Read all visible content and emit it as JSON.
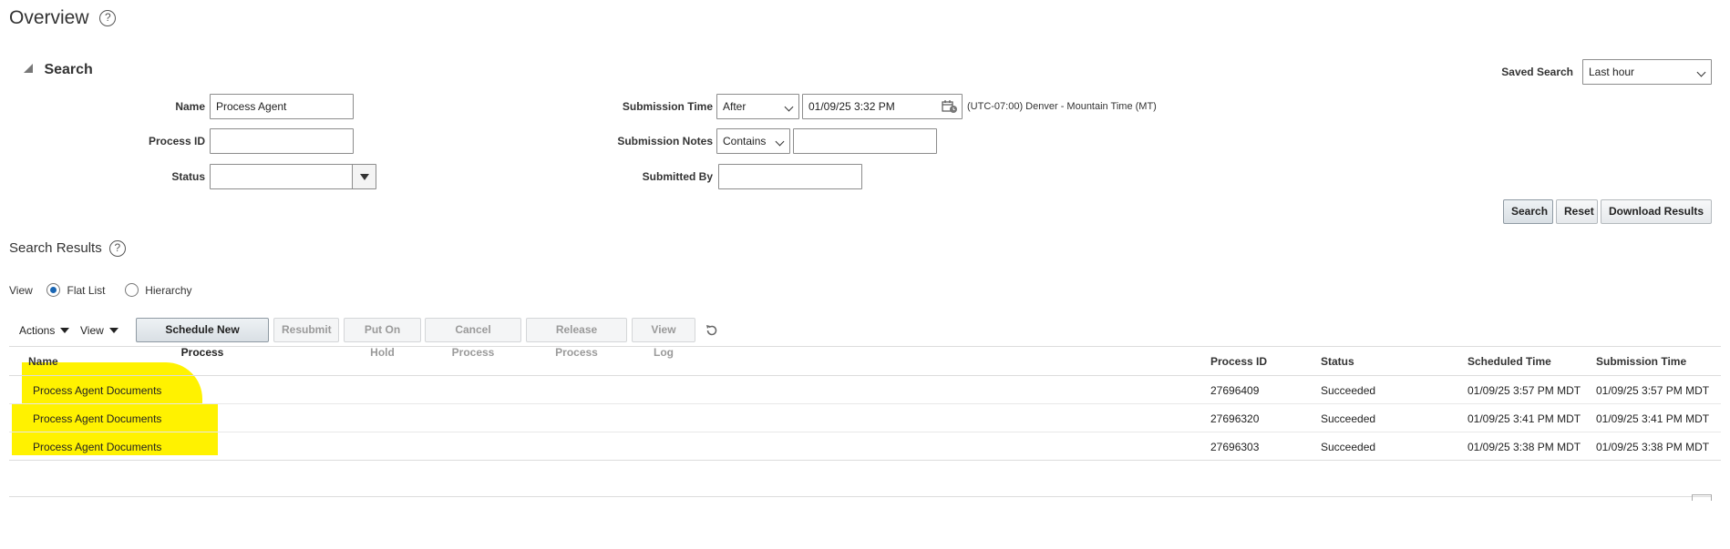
{
  "page": {
    "title": "Overview"
  },
  "search": {
    "header": "Search",
    "saved_search_label": "Saved Search",
    "saved_search_value": "Last hour",
    "name_label": "Name",
    "name_value": "Process Agent",
    "process_id_label": "Process ID",
    "process_id_value": "",
    "status_label": "Status",
    "status_value": "",
    "submission_time_label": "Submission Time",
    "submission_time_op": "After",
    "submission_time_value": "01/09/25 3:32 PM",
    "timezone": "(UTC-07:00) Denver - Mountain Time (MT)",
    "submission_notes_label": "Submission Notes",
    "submission_notes_op": "Contains",
    "submission_notes_value": "",
    "submitted_by_label": "Submitted By",
    "submitted_by_value": "",
    "buttons": {
      "search": "Search",
      "reset": "Reset",
      "download": "Download Results"
    }
  },
  "results": {
    "header": "Search Results",
    "view_label": "View",
    "view_options": [
      "Flat List",
      "Hierarchy"
    ],
    "view_selected": "Flat List",
    "toolbar": {
      "actions": "Actions",
      "view": "View",
      "schedule": "Schedule New Process",
      "resubmit": "Resubmit",
      "put_on_hold": "Put On Hold",
      "cancel": "Cancel Process",
      "release": "Release Process",
      "view_log": "View Log"
    },
    "columns": [
      "Name",
      "Process ID",
      "Status",
      "Scheduled Time",
      "Submission Time"
    ],
    "rows": [
      {
        "name": "Process Agent Documents",
        "process_id": "27696409",
        "status": "Succeeded",
        "scheduled": "01/09/25 3:57 PM MDT",
        "submitted": "01/09/25 3:57 PM MDT"
      },
      {
        "name": "Process Agent Documents",
        "process_id": "27696320",
        "status": "Succeeded",
        "scheduled": "01/09/25 3:41 PM MDT",
        "submitted": "01/09/25 3:41 PM MDT"
      },
      {
        "name": "Process Agent Documents",
        "process_id": "27696303",
        "status": "Succeeded",
        "scheduled": "01/09/25 3:38 PM MDT",
        "submitted": "01/09/25 3:38 PM MDT"
      }
    ]
  },
  "colors": {
    "highlight": "#fff200",
    "radio_selected": "#1a66b3"
  },
  "icons": [
    "help-icon",
    "collapse-triangle-icon",
    "calendar-icon",
    "chevron-down-icon",
    "refresh-icon"
  ]
}
